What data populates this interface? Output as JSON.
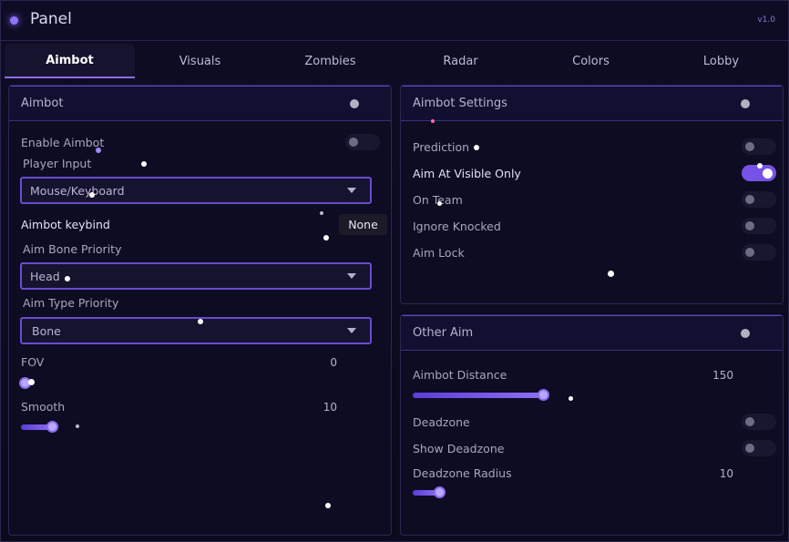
{
  "title": "Panel",
  "version": "v1.0",
  "tabs": [
    {
      "label": "Aimbot"
    },
    {
      "label": "Visuals"
    },
    {
      "label": "Zombies"
    },
    {
      "label": "Radar"
    },
    {
      "label": "Colors"
    },
    {
      "label": "Lobby"
    }
  ],
  "aimbot_panel": {
    "title": "Aimbot",
    "enable_aimbot": {
      "label": "Enable Aimbot",
      "enabled": false
    },
    "player_input": {
      "label": "Player Input",
      "value": "Mouse/Keyboard"
    },
    "keybind": {
      "label": "Aimbot keybind",
      "value": "None"
    },
    "bone_priority": {
      "label": "Aim Bone Priority",
      "value": "Head"
    },
    "type_priority": {
      "label": "Aim Type Priority",
      "value": "Bone"
    },
    "fov": {
      "label": "FOV",
      "value": "0",
      "fraction": 0.0
    },
    "smooth": {
      "label": "Smooth",
      "value": "10",
      "fraction": 0.1
    }
  },
  "settings_panel": {
    "title": "Aimbot Settings",
    "items": [
      {
        "label": "Prediction",
        "enabled": false
      },
      {
        "label": "Aim At Visible Only",
        "enabled": true
      },
      {
        "label": "On Team",
        "enabled": false
      },
      {
        "label": "Ignore Knocked",
        "enabled": false
      },
      {
        "label": "Aim Lock",
        "enabled": false
      }
    ]
  },
  "other_panel": {
    "title": "Other Aim",
    "distance": {
      "label": "Aimbot Distance",
      "value": "150",
      "fraction": 0.4
    },
    "deadzone": {
      "label": "Deadzone",
      "enabled": false
    },
    "show_deadzone": {
      "label": "Show Deadzone",
      "enabled": false
    },
    "deadzone_radius": {
      "label": "Deadzone Radius",
      "value": "10",
      "fraction": 0.1
    }
  },
  "colors": {
    "accent": "#8d6cf2",
    "background": "#0a0a1c",
    "panel": "#0d0c22"
  }
}
